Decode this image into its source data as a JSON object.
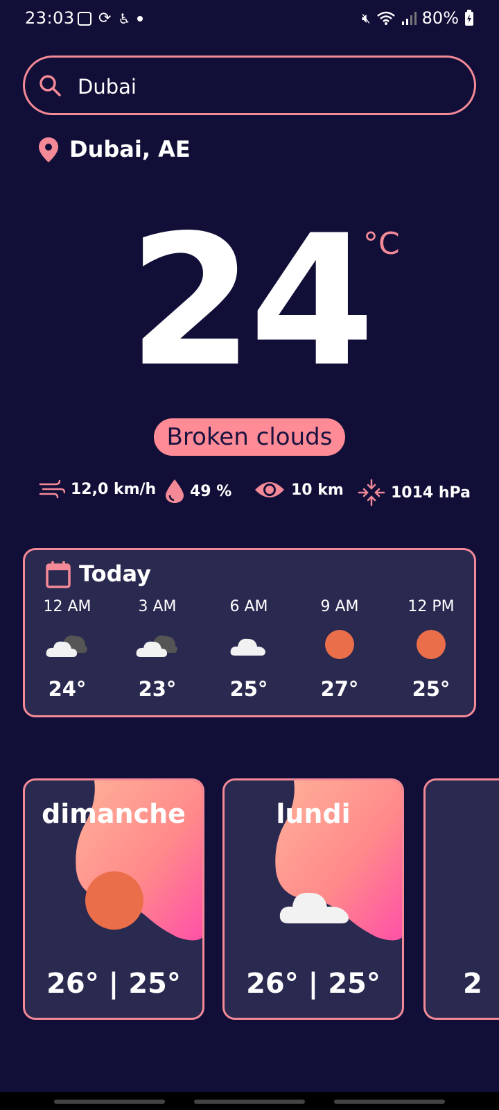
{
  "status_bar": {
    "time": "23:03",
    "battery": "80%",
    "icons": [
      "image-icon",
      "sync-icon",
      "accessibility-icon",
      "dot-icon",
      "mute-icon",
      "wifi-icon",
      "signal-icon",
      "battery-icon"
    ]
  },
  "search": {
    "value": "Dubai",
    "placeholder": ""
  },
  "location": {
    "label": "Dubai, AE"
  },
  "current": {
    "temperature": "24",
    "unit": "°C",
    "condition": "Broken clouds"
  },
  "stats": {
    "wind": "12,0 km/h",
    "humidity": "49 %",
    "visibility": "10 km",
    "pressure": "1014 hPa"
  },
  "today": {
    "title": "Today",
    "hours": [
      {
        "time": "12 AM",
        "icon": "dark-cloud-icon",
        "temp": "24°"
      },
      {
        "time": "3 AM",
        "icon": "dark-cloud-icon",
        "temp": "23°"
      },
      {
        "time": "6 AM",
        "icon": "cloud-icon",
        "temp": "25°"
      },
      {
        "time": "9 AM",
        "icon": "sun-icon",
        "temp": "27°"
      },
      {
        "time": "12 PM",
        "icon": "sun-icon",
        "temp": "25°"
      }
    ]
  },
  "daily": [
    {
      "day": "dimanche",
      "icon": "sun-icon",
      "temps": "26° | 25°"
    },
    {
      "day": "lundi",
      "icon": "cloud-icon",
      "temps": "26° | 25°"
    },
    {
      "day": "",
      "icon": "",
      "temps": "2"
    }
  ],
  "colors": {
    "background": "#110f38",
    "accent": "#f48a97",
    "card": "#2a2950",
    "sun": "#eb6e4b"
  }
}
